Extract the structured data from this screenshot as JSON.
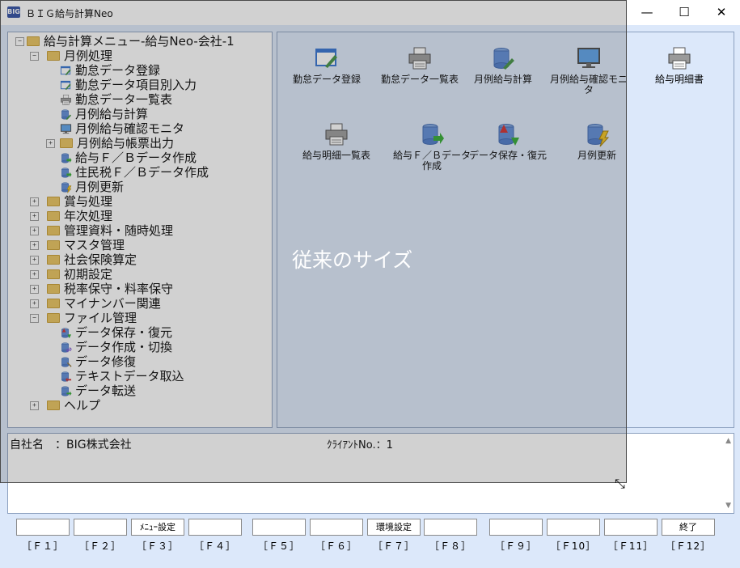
{
  "window": {
    "title": "ＢＩＧ給与計算Neo",
    "app_icon": "BIG",
    "controls": {
      "minimize": "—",
      "maximize": "☐",
      "close": "✕"
    }
  },
  "tree": {
    "root": "給与計算メニュー-給与Neo-会社-1",
    "items": [
      {
        "label": "月例処理",
        "icon": "folder-open"
      },
      {
        "label": "勤怠データ登録",
        "icon": "form-pencil-icon"
      },
      {
        "label": "勤怠データ項目別入力",
        "icon": "form-pencil-icon"
      },
      {
        "label": "勤怠データ一覧表",
        "icon": "printer-icon"
      },
      {
        "label": "月例給与計算",
        "icon": "database-pencil-icon"
      },
      {
        "label": "月例給与確認モニタ",
        "icon": "monitor-icon"
      },
      {
        "label": "月例給与帳票出力",
        "icon": "folder"
      },
      {
        "label": "給与Ｆ／Ｂデータ作成",
        "icon": "database-export-icon"
      },
      {
        "label": "住民税Ｆ／Ｂデータ作成",
        "icon": "database-export-icon"
      },
      {
        "label": "月例更新",
        "icon": "database-lightning-icon"
      },
      {
        "label": "賞与処理",
        "icon": "folder"
      },
      {
        "label": "年次処理",
        "icon": "folder"
      },
      {
        "label": "管理資料・随時処理",
        "icon": "folder"
      },
      {
        "label": "マスタ管理",
        "icon": "folder"
      },
      {
        "label": "社会保険算定",
        "icon": "folder"
      },
      {
        "label": "初期設定",
        "icon": "folder"
      },
      {
        "label": "税率保守・料率保守",
        "icon": "folder"
      },
      {
        "label": "マイナンバー関連",
        "icon": "folder"
      },
      {
        "label": "ファイル管理",
        "icon": "folder-open"
      },
      {
        "label": "データ保存・復元",
        "icon": "database-updown-icon"
      },
      {
        "label": "データ作成・切換",
        "icon": "database-switch-icon"
      },
      {
        "label": "データ修復",
        "icon": "database-repair-icon"
      },
      {
        "label": "テキストデータ取込",
        "icon": "database-import-icon"
      },
      {
        "label": "データ転送",
        "icon": "database-transfer-icon"
      },
      {
        "label": "ヘルプ",
        "icon": "folder"
      }
    ]
  },
  "icons": [
    {
      "label": "勤怠データ登録",
      "icon": "form-pencil-icon"
    },
    {
      "label": "勤怠データ一覧表",
      "icon": "printer-icon"
    },
    {
      "label": "月例給与計算",
      "icon": "database-pencil-icon"
    },
    {
      "label": "月例給与確認モニタ",
      "icon": "monitor-icon"
    },
    {
      "label": "給与明細書",
      "icon": "printer-icon"
    },
    {
      "label": "給与明細一覧表",
      "icon": "printer-icon"
    },
    {
      "label": "給与Ｆ／Ｂデータ作成",
      "icon": "database-export-icon"
    },
    {
      "label": "データ保存・復元",
      "icon": "database-updown-icon"
    },
    {
      "label": "月例更新",
      "icon": "database-lightning-icon"
    }
  ],
  "info": {
    "company": "自社名　：BIG株式会社",
    "client_no": "ｸﾗｲｱﾝﾄNo.：1"
  },
  "overlay": {
    "label": "従来のサイズ"
  },
  "fkeys": [
    {
      "key": "［Ｆ１］",
      "label": ""
    },
    {
      "key": "［Ｆ２］",
      "label": ""
    },
    {
      "key": "［Ｆ３］",
      "label": "ﾒﾆｭｰ設定"
    },
    {
      "key": "［Ｆ４］",
      "label": ""
    },
    {
      "key": "［Ｆ５］",
      "label": ""
    },
    {
      "key": "［Ｆ６］",
      "label": ""
    },
    {
      "key": "［Ｆ７］",
      "label": "環境設定"
    },
    {
      "key": "［Ｆ８］",
      "label": ""
    },
    {
      "key": "［Ｆ９］",
      "label": ""
    },
    {
      "key": "［Ｆ10］",
      "label": ""
    },
    {
      "key": "［Ｆ11］",
      "label": ""
    },
    {
      "key": "［Ｆ12］",
      "label": "終了"
    }
  ],
  "colors": {
    "accent": "#2b4aa0",
    "pane_bg": "#dce8fa",
    "border": "#8ca0bf"
  }
}
